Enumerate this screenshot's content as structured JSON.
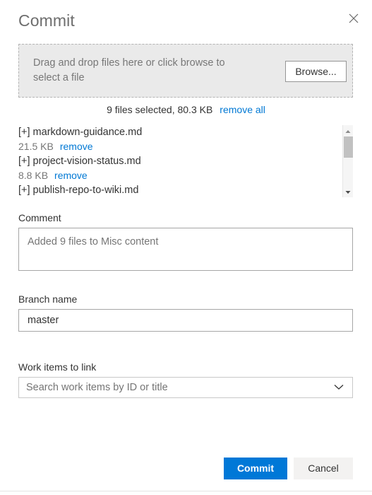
{
  "dialog": {
    "title": "Commit",
    "close_icon": "close-icon"
  },
  "dropzone": {
    "text": "Drag and drop files here or click browse to select a file",
    "browse_label": "Browse..."
  },
  "summary": {
    "text": "9 files selected, 80.3 KB",
    "remove_all_label": "remove all"
  },
  "files": [
    {
      "name": "[+] markdown-guidance.md",
      "size": "21.5 KB",
      "remove_label": "remove"
    },
    {
      "name": "[+] project-vision-status.md",
      "size": "8.8 KB",
      "remove_label": "remove"
    },
    {
      "name": "[+] publish-repo-to-wiki.md",
      "size": "",
      "remove_label": ""
    }
  ],
  "scrollbar": {
    "up_icon": "caret-up-icon",
    "down_icon": "caret-down-icon"
  },
  "comment": {
    "label": "Comment",
    "value": "Added 9 files to Misc content",
    "placeholder": "Added 9 files to Misc content"
  },
  "branch": {
    "label": "Branch name",
    "value": "master",
    "placeholder": "Branch name"
  },
  "work_items": {
    "label": "Work items to link",
    "value": "",
    "placeholder": "Search work items by ID or title",
    "chevron_icon": "chevron-down-icon"
  },
  "footer": {
    "commit_label": "Commit",
    "cancel_label": "Cancel"
  },
  "colors": {
    "accent": "#0078d4",
    "primary_button": "#0078d7",
    "secondary_button": "#f3f2f1",
    "dropzone_bg": "#eaeaea",
    "scroll_thumb": "#c1c1c1"
  }
}
